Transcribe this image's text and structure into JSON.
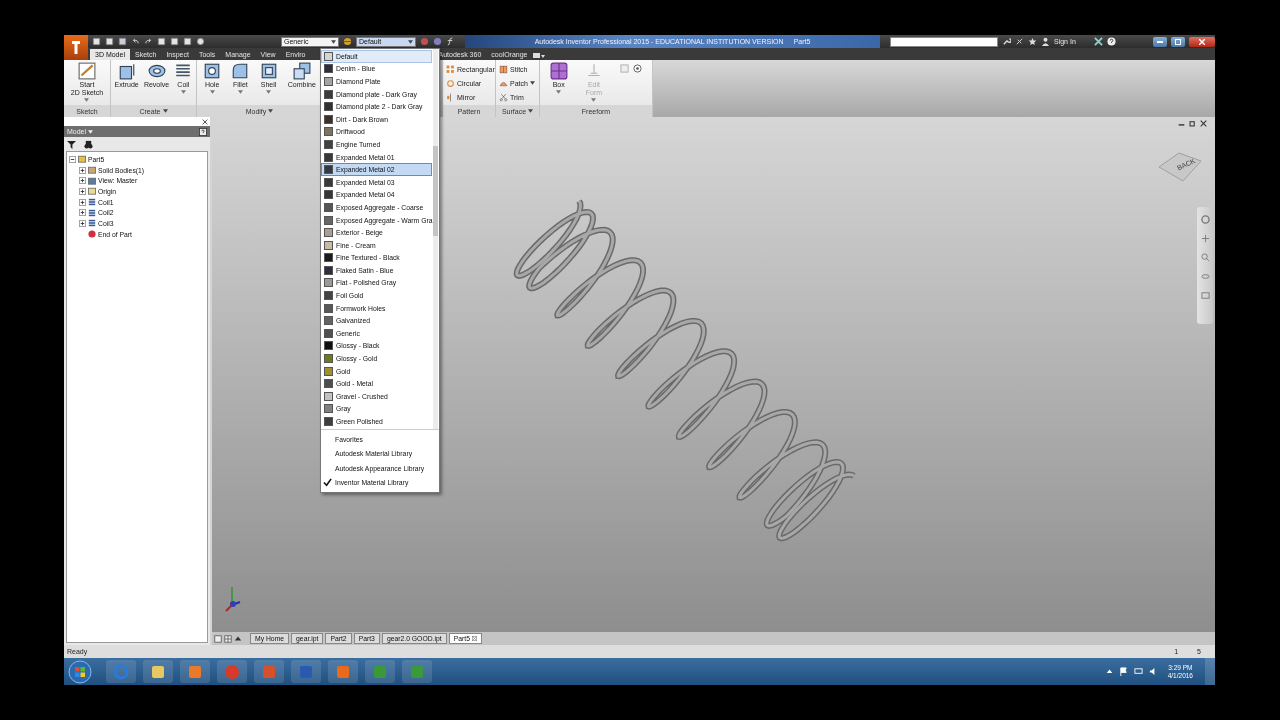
{
  "title_bar": {
    "style_combo": "Generic",
    "appearance_combo": "Default",
    "title": "Autodesk Inventor Professional 2015 - EDUCATIONAL INSTITUTION VERSION",
    "document": "Part5",
    "sign_in": "Sign In"
  },
  "ribbon_tabs": [
    {
      "label": "3D Model",
      "selected": true
    },
    {
      "label": "Sketch",
      "selected": false
    },
    {
      "label": "Inspect",
      "selected": false
    },
    {
      "label": "Tools",
      "selected": false
    },
    {
      "label": "Manage",
      "selected": false
    },
    {
      "label": "View",
      "selected": false
    },
    {
      "label": "Enviro",
      "selected": false
    },
    {
      "label": "Autodesk 360",
      "selected": false
    },
    {
      "label": "coolOrange",
      "selected": false
    }
  ],
  "ribbon_panels": [
    {
      "label": "Sketch",
      "menu": false,
      "kind": "large",
      "tools": [
        {
          "label": "Start\n2D Sketch",
          "kind": "sketch",
          "menu": true,
          "disabled": false
        }
      ]
    },
    {
      "label": "Create",
      "menu": true,
      "kind": "large",
      "tools": [
        {
          "label": "Extrude",
          "kind": "extrude",
          "menu": false,
          "disabled": false
        },
        {
          "label": "Revolve",
          "kind": "revolve",
          "menu": false,
          "disabled": false
        },
        {
          "label": "Coil",
          "kind": "coil",
          "menu": true,
          "disabled": false
        }
      ]
    },
    {
      "label": "Modify",
      "menu": true,
      "kind": "large",
      "tools": [
        {
          "label": "Hole",
          "kind": "hole",
          "menu": true,
          "disabled": false
        },
        {
          "label": "Fillet",
          "kind": "fillet",
          "menu": true,
          "disabled": false
        },
        {
          "label": "Shell",
          "kind": "shell",
          "menu": true,
          "disabled": false
        },
        {
          "label": "Combine",
          "kind": "combine",
          "menu": false,
          "disabled": false
        }
      ]
    },
    {
      "label": "Pattern",
      "menu": false,
      "kind": "small",
      "tools": [
        {
          "label": "Rectangular",
          "kind": "rectangular",
          "menu": false,
          "disabled": false
        },
        {
          "label": "Circular",
          "kind": "circular",
          "menu": false,
          "disabled": false
        },
        {
          "label": "Mirror",
          "kind": "mirror",
          "menu": false,
          "disabled": false
        }
      ]
    },
    {
      "label": "Surface",
      "menu": true,
      "kind": "small",
      "tools": [
        {
          "label": "Stitch",
          "kind": "stitch",
          "menu": false,
          "disabled": false
        },
        {
          "label": "Patch",
          "kind": "patch",
          "menu": true,
          "disabled": false
        },
        {
          "label": "Trim",
          "kind": "trim",
          "menu": false,
          "disabled": false
        }
      ]
    },
    {
      "label": "Freeform",
      "menu": false,
      "kind": "large",
      "tools": [
        {
          "label": "Box",
          "kind": "box",
          "menu": true,
          "disabled": false
        },
        {
          "label": "Edit\nForm",
          "kind": "edit_form",
          "menu": true,
          "disabled": true
        }
      ]
    }
  ],
  "appearance_menu": {
    "items": [
      {
        "label": "Default",
        "color": "#d4d4d4",
        "selected": true,
        "hovered": false
      },
      {
        "label": "Denim - Blue",
        "color": "#2b2f3d",
        "selected": false,
        "hovered": false
      },
      {
        "label": "Diamond Plate",
        "color": "#a4a4a4",
        "selected": false,
        "hovered": false
      },
      {
        "label": "Diamond plate - Dark Gray",
        "color": "#3c3c3c",
        "selected": false,
        "hovered": false
      },
      {
        "label": "Diamond plate 2 - Dark Gray",
        "color": "#303030",
        "selected": false,
        "hovered": false
      },
      {
        "label": "Dirt - Dark Brown",
        "color": "#3b2f27",
        "selected": false,
        "hovered": false
      },
      {
        "label": "Driftwood",
        "color": "#7a7560",
        "selected": false,
        "hovered": false
      },
      {
        "label": "Engine Turned",
        "color": "#414141",
        "selected": false,
        "hovered": false
      },
      {
        "label": "Expanded Metal 01",
        "color": "#383838",
        "selected": false,
        "hovered": false
      },
      {
        "label": "Expanded Metal 02",
        "color": "#363a40",
        "selected": false,
        "hovered": true
      },
      {
        "label": "Expanded Metal 03",
        "color": "#3a3a3a",
        "selected": false,
        "hovered": false
      },
      {
        "label": "Expanded Metal 04",
        "color": "#353535",
        "selected": false,
        "hovered": false
      },
      {
        "label": "Exposed Aggregate - Coarse",
        "color": "#555555",
        "selected": false,
        "hovered": false
      },
      {
        "label": "Exposed Aggregate - Warm Gra",
        "color": "#6a6560",
        "selected": false,
        "hovered": false
      },
      {
        "label": "Exterior - Beige",
        "color": "#a8a090",
        "selected": false,
        "hovered": false
      },
      {
        "label": "Fine - Cream",
        "color": "#c8bca0",
        "selected": false,
        "hovered": false
      },
      {
        "label": "Fine Textured - Black",
        "color": "#1a1a1a",
        "selected": false,
        "hovered": false
      },
      {
        "label": "Flaked Satin - Blue",
        "color": "#2a3040",
        "selected": false,
        "hovered": false
      },
      {
        "label": "Flat - Polished Gray",
        "color": "#9a9a9a",
        "selected": false,
        "hovered": false
      },
      {
        "label": "Foil Gold",
        "color": "#444444",
        "selected": false,
        "hovered": false
      },
      {
        "label": "Formwork Holes",
        "color": "#585858",
        "selected": false,
        "hovered": false
      },
      {
        "label": "Galvanized",
        "color": "#626262",
        "selected": false,
        "hovered": false
      },
      {
        "label": "Generic",
        "color": "#505050",
        "selected": false,
        "hovered": false
      },
      {
        "label": "Glossy - Black",
        "color": "#101010",
        "selected": false,
        "hovered": false
      },
      {
        "label": "Glossy - Gold",
        "color": "#6a7a20",
        "selected": false,
        "hovered": false
      },
      {
        "label": "Gold",
        "color": "#a09030",
        "selected": false,
        "hovered": false
      },
      {
        "label": "Gold - Metal",
        "color": "#4e4e4e",
        "selected": false,
        "hovered": false
      },
      {
        "label": "Gravel - Crushed",
        "color": "#c2c2c2",
        "selected": false,
        "hovered": false
      },
      {
        "label": "Gray",
        "color": "#808080",
        "selected": false,
        "hovered": false
      },
      {
        "label": "Green Polished",
        "color": "#3e3e3e",
        "selected": false,
        "hovered": false
      }
    ],
    "libraries": [
      {
        "label": "Favorites",
        "checked": false
      },
      {
        "label": "Autodesk Material Library",
        "checked": false
      },
      {
        "label": "Autodesk Appearance Library",
        "checked": false
      },
      {
        "label": "Inventor Material Library",
        "checked": true
      }
    ]
  },
  "browser": {
    "title": "Model",
    "tree": [
      {
        "label": "Part5",
        "kind": "part",
        "expanded": true,
        "children": [
          {
            "label": "Solid Bodies(1)",
            "kind": "bodies",
            "expanded": false
          },
          {
            "label": "View: Master",
            "kind": "view",
            "expanded": false
          },
          {
            "label": "Origin",
            "kind": "folder",
            "expanded": false
          },
          {
            "label": "Coil1",
            "kind": "coil",
            "expanded": false
          },
          {
            "label": "Coil2",
            "kind": "coil",
            "expanded": false
          },
          {
            "label": "Coil3",
            "kind": "coil",
            "expanded": false
          },
          {
            "label": "End of Part",
            "kind": "end"
          }
        ]
      }
    ]
  },
  "viewcube": {
    "face": "BACK"
  },
  "doc_tabs": [
    {
      "label": "My Home",
      "selected": false
    },
    {
      "label": "gear.ipt",
      "selected": false
    },
    {
      "label": "Part2",
      "selected": false
    },
    {
      "label": "Part3",
      "selected": false
    },
    {
      "label": "gear2.0 GOOD.ipt",
      "selected": false
    },
    {
      "label": "Part5",
      "selected": true
    }
  ],
  "status_bar": {
    "text": "Ready",
    "values": [
      "1",
      "5"
    ]
  },
  "taskbar": {
    "time": "3:29 PM",
    "date": "4/1/2016"
  }
}
